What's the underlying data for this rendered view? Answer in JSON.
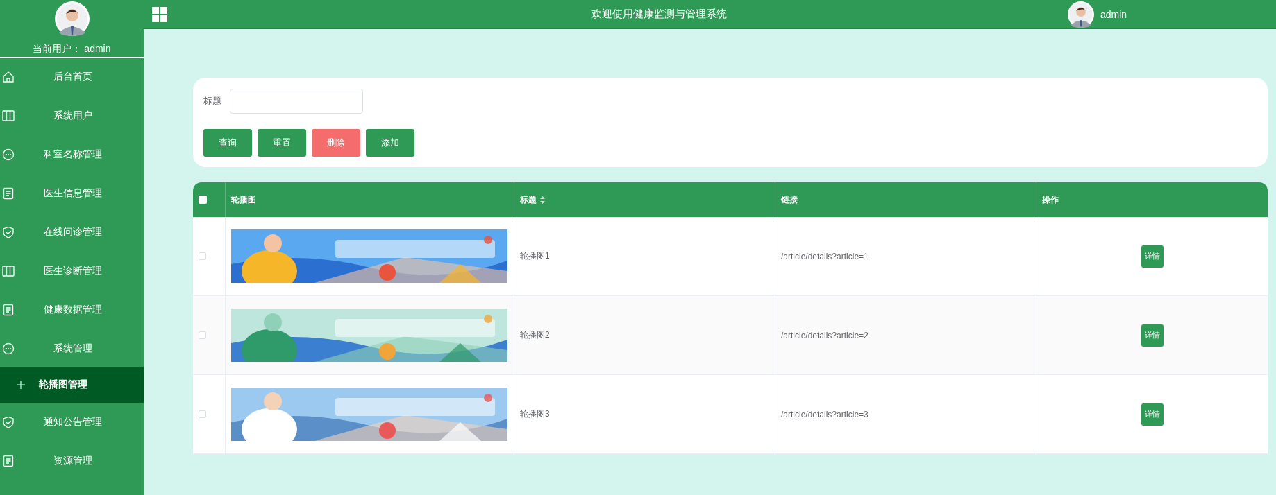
{
  "sidebar": {
    "user_label": "当前用户： admin",
    "items": [
      {
        "label": "后台首页",
        "kind": "home",
        "selected": false
      },
      {
        "label": "系统用户",
        "kind": "columns",
        "selected": false
      },
      {
        "label": "科室名称管理",
        "kind": "chat",
        "selected": false
      },
      {
        "label": "医生信息管理",
        "kind": "document",
        "selected": false
      },
      {
        "label": "在线问诊管理",
        "kind": "shield",
        "selected": false
      },
      {
        "label": "医生诊断管理",
        "kind": "columns",
        "selected": false
      },
      {
        "label": "健康数据管理",
        "kind": "document",
        "selected": false
      },
      {
        "label": "系统管理",
        "kind": "chat",
        "selected": false
      },
      {
        "label": "轮播图管理",
        "kind": "plus",
        "selected": true
      },
      {
        "label": "通知公告管理",
        "kind": "shield",
        "selected": false
      },
      {
        "label": "资源管理",
        "kind": "document",
        "selected": false
      }
    ]
  },
  "topbar": {
    "title": "欢迎使用健康监测与管理系统",
    "user": "admin"
  },
  "search": {
    "field_label": "标题",
    "buttons": [
      {
        "label": "查询",
        "kind": "primary"
      },
      {
        "label": "重置",
        "kind": "primary"
      },
      {
        "label": "删除",
        "kind": "danger"
      },
      {
        "label": "添加",
        "kind": "primary"
      }
    ]
  },
  "table": {
    "select_all": {
      "checked": false
    },
    "columns": [
      {
        "label": "轮播图",
        "kind": "plain"
      },
      {
        "label": "标题",
        "kind": "sortable"
      },
      {
        "label": "链接",
        "kind": "plain"
      },
      {
        "label": "操作",
        "kind": "plain"
      }
    ],
    "rows": [
      {
        "checked": false,
        "title": "轮播图1",
        "link": "/article/details?article=1",
        "action": "详情"
      },
      {
        "checked": false,
        "title": "轮播图2",
        "link": "/article/details?article=2",
        "action": "详情"
      },
      {
        "checked": false,
        "title": "轮播图3",
        "link": "/article/details?article=3",
        "action": "详情"
      }
    ]
  }
}
